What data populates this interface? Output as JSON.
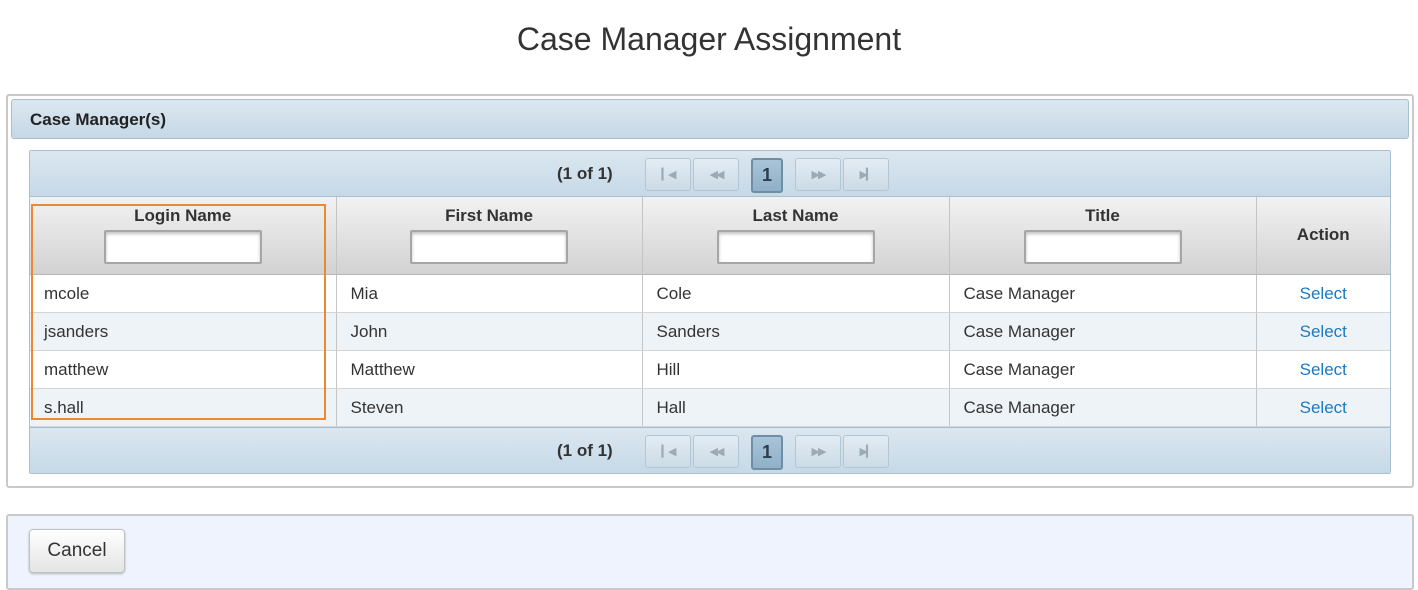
{
  "page": {
    "title": "Case Manager Assignment"
  },
  "panel": {
    "header": "Case Manager(s)"
  },
  "pager": {
    "count_text": "(1 of 1)",
    "current_page": "1",
    "first_icon": "first-page-icon",
    "prev_icon": "prev-page-icon",
    "next_icon": "next-page-icon",
    "last_icon": "last-page-icon"
  },
  "table": {
    "columns": [
      {
        "label": "Login Name",
        "filter": ""
      },
      {
        "label": "First Name",
        "filter": ""
      },
      {
        "label": "Last Name",
        "filter": ""
      },
      {
        "label": "Title",
        "filter": ""
      },
      {
        "label": "Action"
      }
    ],
    "rows": [
      {
        "login": "mcole",
        "first": "Mia",
        "last": "Cole",
        "title": "Case Manager",
        "action": "Select"
      },
      {
        "login": "jsanders",
        "first": "John",
        "last": "Sanders",
        "title": "Case Manager",
        "action": "Select"
      },
      {
        "login": "matthew",
        "first": "Matthew",
        "last": "Hill",
        "title": "Case Manager",
        "action": "Select"
      },
      {
        "login": "s.hall",
        "first": "Steven",
        "last": "Hall",
        "title": "Case Manager",
        "action": "Select"
      }
    ]
  },
  "footer": {
    "cancel_label": "Cancel"
  },
  "colors": {
    "link": "#1a7ac4",
    "highlight": "#e98a2e",
    "header_bg": "#c5d8e6"
  }
}
